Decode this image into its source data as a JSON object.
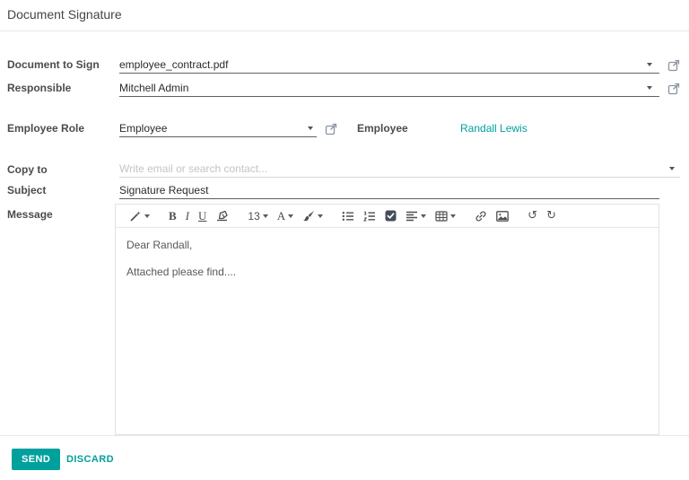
{
  "window": {
    "title": "Document Signature"
  },
  "form": {
    "document_to_sign": {
      "label": "Document to Sign",
      "value": "employee_contract.pdf"
    },
    "responsible": {
      "label": "Responsible",
      "value": "Mitchell Admin"
    },
    "employee_role": {
      "label": "Employee Role",
      "value": "Employee"
    },
    "employee": {
      "label": "Employee",
      "value": "Randall Lewis"
    },
    "copy_to": {
      "label": "Copy to",
      "placeholder": "Write email or search contact..."
    },
    "subject": {
      "label": "Subject",
      "value": "Signature Request"
    },
    "message": {
      "label": "Message",
      "line1": "Dear Randall,",
      "line2": "Attached please find...."
    }
  },
  "editor_toolbar": {
    "bold_label": "B",
    "italic_label": "I",
    "underline_label": "U",
    "font_size": "13",
    "text_color_label": "A",
    "undo_glyph": "↺",
    "redo_glyph": "↻",
    "icon_names": [
      "style-dropdown",
      "bold",
      "italic",
      "underline",
      "remove-format-eraser",
      "font-size-dropdown",
      "text-color-dropdown",
      "highlight-color-dropdown",
      "unordered-list",
      "ordered-list",
      "checklist",
      "align-dropdown",
      "table-dropdown",
      "link",
      "image",
      "undo",
      "redo"
    ]
  },
  "footer": {
    "send": "SEND",
    "discard": "DISCARD"
  },
  "colors": {
    "accent": "#00a09d",
    "link": "#00a09d",
    "label_text": "#4c4c4c",
    "value_text": "#2b2b2b",
    "placeholder": "#c4c4c4",
    "underline_dark": "#616161",
    "underline_light": "#d8d8d8",
    "editor_border": "#e2e2e2",
    "divider": "#e7e7e7",
    "toolbar_icon": "#4d4d4d"
  }
}
